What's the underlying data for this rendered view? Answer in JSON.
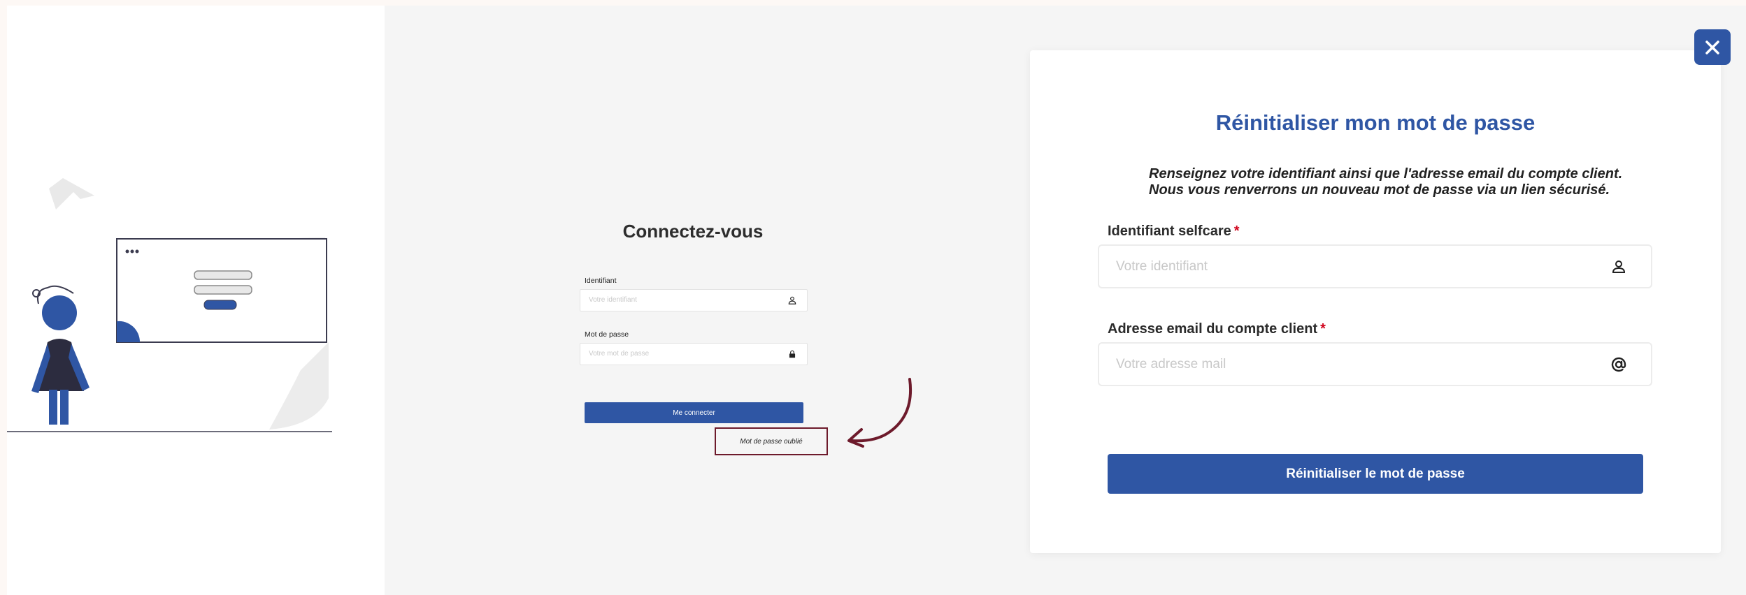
{
  "login": {
    "title": "Connectez-vous",
    "identifiant_label": "Identifiant",
    "identifiant_placeholder": "Votre identifiant",
    "password_label": "Mot de passe",
    "password_placeholder": "Votre mot de passe",
    "submit_label": "Me connecter",
    "forgot_label": "Mot de passe oublié"
  },
  "modal": {
    "title": "Réinitialiser mon mot de passe",
    "description_line1": "Renseignez votre identifiant ainsi que l'adresse email du compte client.",
    "description_line2": "Nous vous renverrons un nouveau mot de passe via un lien sécurisé.",
    "identifiant_label": "Identifiant selfcare",
    "identifiant_placeholder": "Votre identifiant",
    "email_label": "Adresse email du compte client",
    "email_placeholder": "Votre adresse mail",
    "required_marker": "*",
    "submit_label": "Réinitialiser le mot de passe",
    "close_icon": "close-icon"
  },
  "icons": {
    "user": "user-icon",
    "lock": "lock-icon",
    "at": "at-sign-icon"
  },
  "colors": {
    "primary": "#2f56a4",
    "highlight_border": "#6d1a2b",
    "required": "#d0021b"
  }
}
